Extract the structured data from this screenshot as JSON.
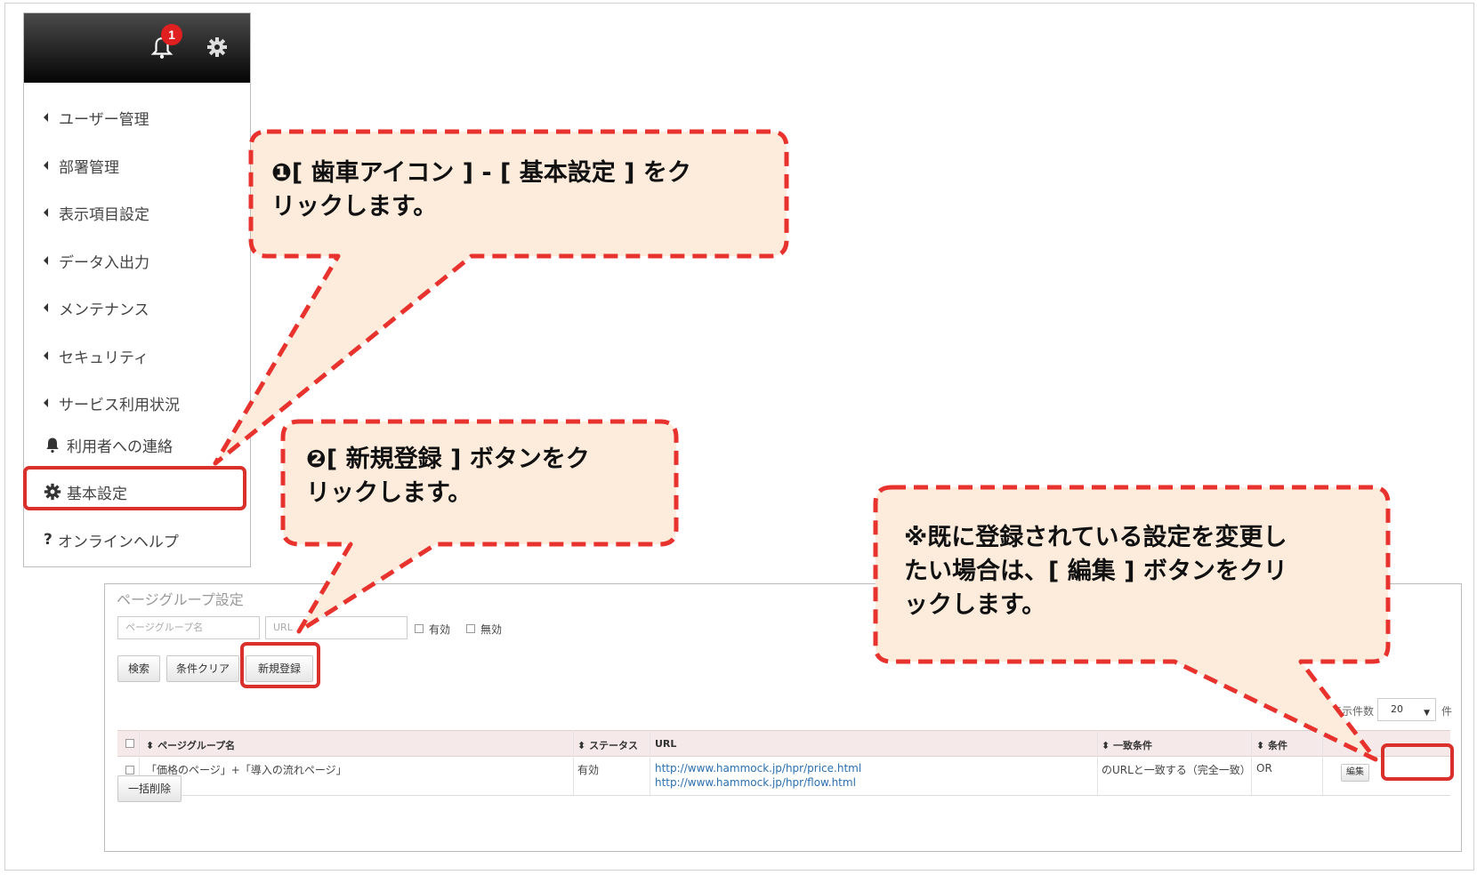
{
  "menu": {
    "badge_count": "1",
    "items": [
      {
        "label": "ユーザー管理"
      },
      {
        "label": "部署管理"
      },
      {
        "label": "表示項目設定"
      },
      {
        "label": "データ入出力"
      },
      {
        "label": "メンテナンス"
      },
      {
        "label": "セキュリティ"
      },
      {
        "label": "サービス利用状況"
      },
      {
        "label": "利用者への連絡"
      },
      {
        "label": "基本設定"
      },
      {
        "label": "オンラインヘルプ"
      }
    ],
    "help_mark": "?"
  },
  "callouts": {
    "step1_line1": "❶[ 歯車アイコン ] - [ 基本設定 ] をク",
    "step1_line2": "リックします。",
    "step2_line1": "❷[ 新規登録 ] ボタンをク",
    "step2_line2": "リックします。",
    "note_line1": "※既に登録されている設定を変更し",
    "note_line2": "たい場合は、[ 編集 ] ボタンをクリ",
    "note_line3": "ックします。"
  },
  "panel": {
    "title": "ページグループ設定",
    "search_name_placeholder": "ページグループ名",
    "search_url_placeholder": "URL",
    "filter_valid": "有効",
    "filter_invalid": "無効",
    "search_button": "検索",
    "clear_button": "条件クリア",
    "new_button": "新規登録",
    "count_label": "表示件数",
    "page_size": "20",
    "count_unit": "件",
    "bulk_delete_button": "一括削除"
  },
  "table": {
    "columns": {
      "name": "ページグループ名",
      "status": "ステータス",
      "url": "URL",
      "match": "一致条件",
      "logic": "条件"
    },
    "rows": [
      {
        "name": "「価格のページ」+「導入の流れページ」",
        "status": "有効",
        "url1": "http://www.hammock.jp/hpr/price.html",
        "url2": "http://www.hammock.jp/hpr/flow.html",
        "match": "のURLと一致する（完全一致）",
        "logic": "OR",
        "edit_label": "編集"
      }
    ]
  },
  "colors": {
    "callout_border": "#e8322e",
    "callout_fill": "#fdebdc",
    "badge": "#e02020",
    "link": "#2a6fb0"
  }
}
